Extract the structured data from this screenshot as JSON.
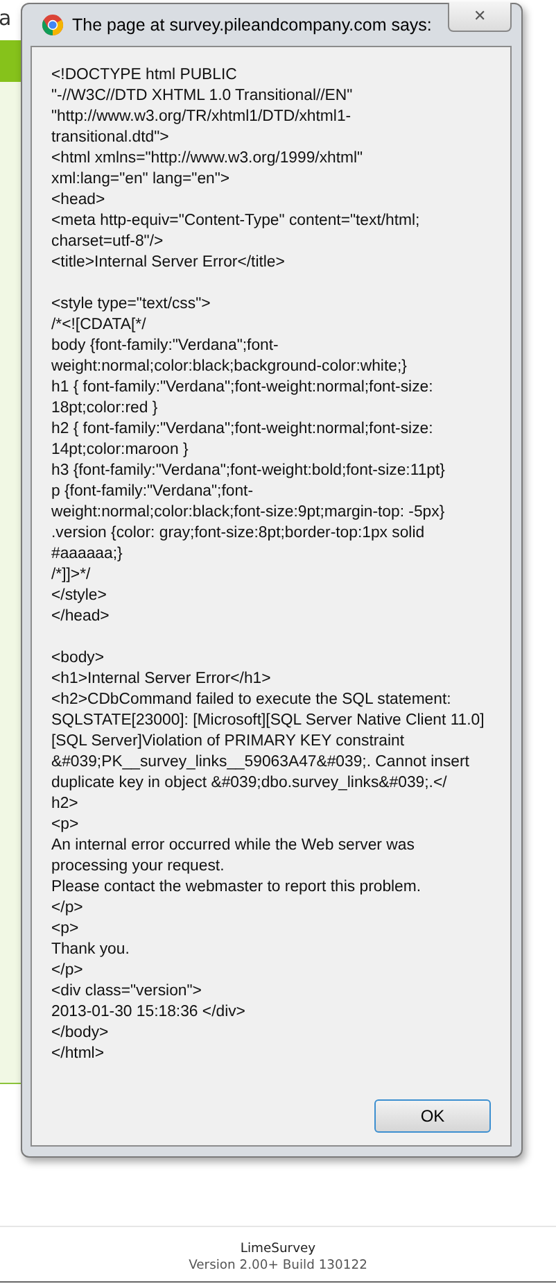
{
  "page": {
    "heading_fragment": "a"
  },
  "dialog": {
    "title": "The page at survey.pileandcompany.com says:",
    "close_label": "✕",
    "message_blocks": [
      [
        "<!DOCTYPE html PUBLIC",
        "\"-//W3C//DTD XHTML 1.0 Transitional//EN\"",
        "\"http://www.w3.org/TR/xhtml1/DTD/xhtml1-",
        "transitional.dtd\">",
        "<html xmlns=\"http://www.w3.org/1999/xhtml\"",
        "xml:lang=\"en\" lang=\"en\">",
        "<head>",
        "<meta http-equiv=\"Content-Type\" content=\"text/html;",
        "charset=utf-8\"/>",
        "<title>Internal Server Error</title>"
      ],
      [
        "<style type=\"text/css\">",
        "/*<![CDATA[*/",
        "body {font-family:\"Verdana\";font-",
        "weight:normal;color:black;background-color:white;}",
        "h1 { font-family:\"Verdana\";font-weight:normal;font-size:",
        "18pt;color:red }",
        "h2 { font-family:\"Verdana\";font-weight:normal;font-size:",
        "14pt;color:maroon }",
        "h3 {font-family:\"Verdana\";font-weight:bold;font-size:11pt}",
        "p {font-family:\"Verdana\";font-",
        "weight:normal;color:black;font-size:9pt;margin-top: -5px}",
        ".version {color: gray;font-size:8pt;border-top:1px solid",
        "#aaaaaa;}",
        "/*]]>*/",
        "</style>",
        "</head>"
      ],
      [
        "<body>",
        "<h1>Internal Server Error</h1>",
        "<h2>CDbCommand failed to execute the SQL statement:",
        "SQLSTATE[23000]: [Microsoft][SQL Server Native Client 11.0]",
        "[SQL Server]Violation of PRIMARY KEY constraint",
        "&#039;PK__survey_links__59063A47&#039;. Cannot insert",
        "duplicate key in object &#039;dbo.survey_links&#039;.</",
        "h2>",
        "<p>",
        "An internal error occurred while the Web server was",
        "processing your request.",
        "Please contact the webmaster to report this problem.",
        "</p>",
        "<p>",
        "Thank you.",
        "</p>",
        "<div class=\"version\">",
        "2013-01-30 15:18:36 </div>",
        "</body>",
        "</html>"
      ]
    ],
    "ok_button": "OK"
  },
  "footer": {
    "product": "LimeSurvey",
    "version": "Version 2.00+ Build 130122"
  }
}
